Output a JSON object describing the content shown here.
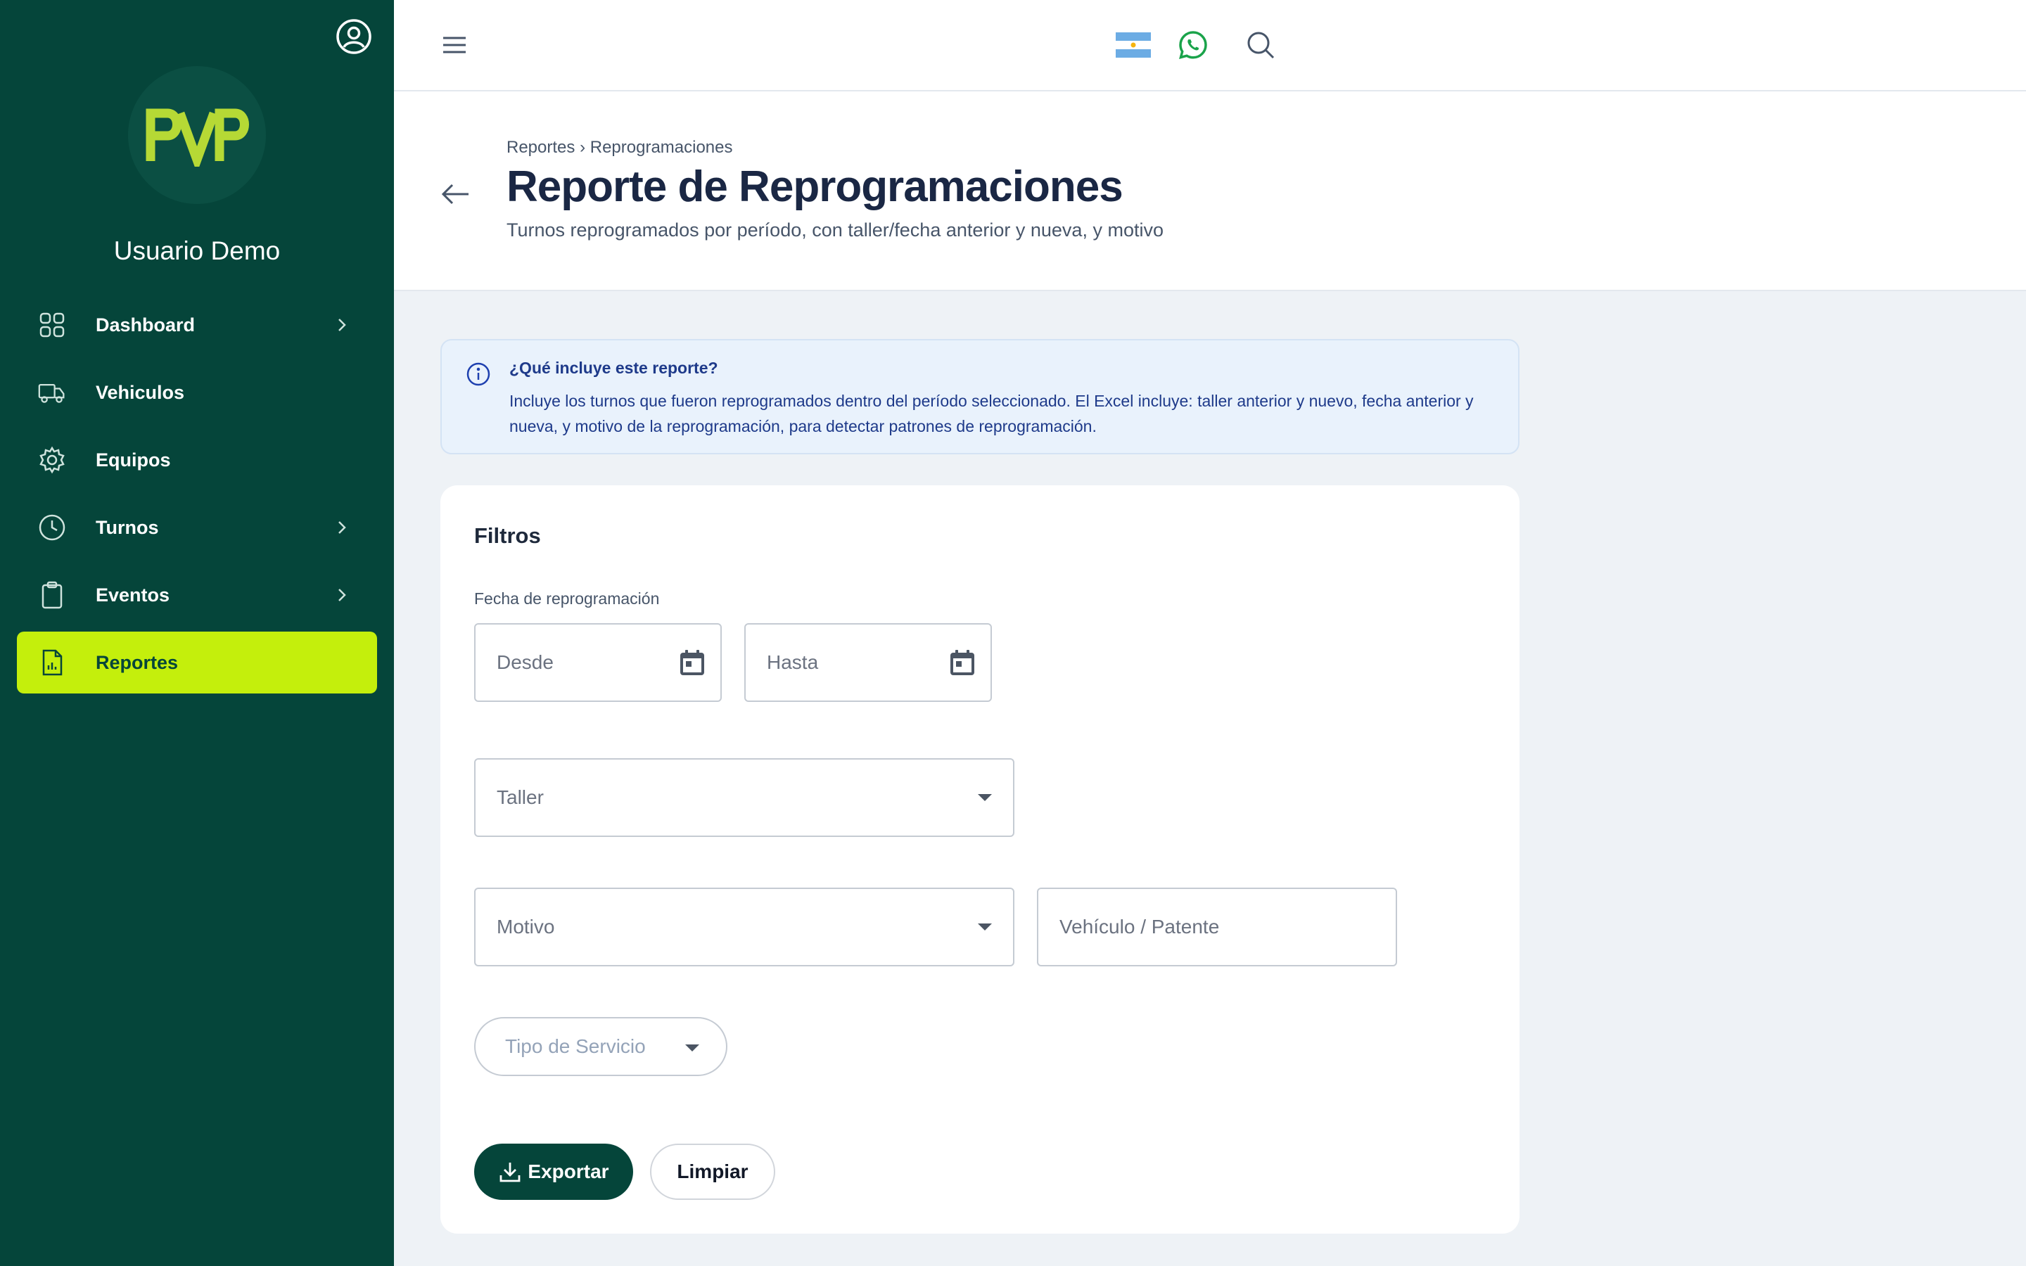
{
  "sidebar": {
    "logo_text": "PVP",
    "user_name": "Usuario Demo",
    "items": [
      {
        "label": "Dashboard",
        "icon": "grid-icon",
        "has_submenu": true
      },
      {
        "label": "Vehiculos",
        "icon": "truck-icon",
        "has_submenu": false
      },
      {
        "label": "Equipos",
        "icon": "gear-icon",
        "has_submenu": false
      },
      {
        "label": "Turnos",
        "icon": "clock-icon",
        "has_submenu": true
      },
      {
        "label": "Eventos",
        "icon": "clipboard-icon",
        "has_submenu": true
      },
      {
        "label": "Reportes",
        "icon": "report-icon",
        "has_submenu": false,
        "active": true
      }
    ]
  },
  "header": {
    "breadcrumb": {
      "parent": "Reportes",
      "separator": "›",
      "current": "Reprogramaciones"
    },
    "title": "Reporte de Reprogramaciones",
    "subtitle": "Turnos reprogramados por período, con taller/fecha anterior y nueva, y motivo"
  },
  "info": {
    "title": "¿Qué incluye este reporte?",
    "text": "Incluye los turnos que fueron reprogramados dentro del período seleccionado. El Excel incluye: taller anterior y nuevo, fecha anterior y nueva, y motivo de la reprogramación, para detectar patrones de reprogramación."
  },
  "filters": {
    "title": "Filtros",
    "date_label": "Fecha de reprogramación",
    "desde_placeholder": "Desde",
    "hasta_placeholder": "Hasta",
    "taller_placeholder": "Taller",
    "motivo_placeholder": "Motivo",
    "vehiculo_placeholder": "Vehículo / Patente",
    "tipo_servicio_placeholder": "Tipo de Servicio"
  },
  "actions": {
    "export_label": "Exportar",
    "clear_label": "Limpiar"
  },
  "colors": {
    "sidebar_bg": "#05453a",
    "accent": "#c4ef0c",
    "primary_button": "#05453a",
    "info_bg": "#e9f2fc",
    "whatsapp": "#25a244"
  }
}
